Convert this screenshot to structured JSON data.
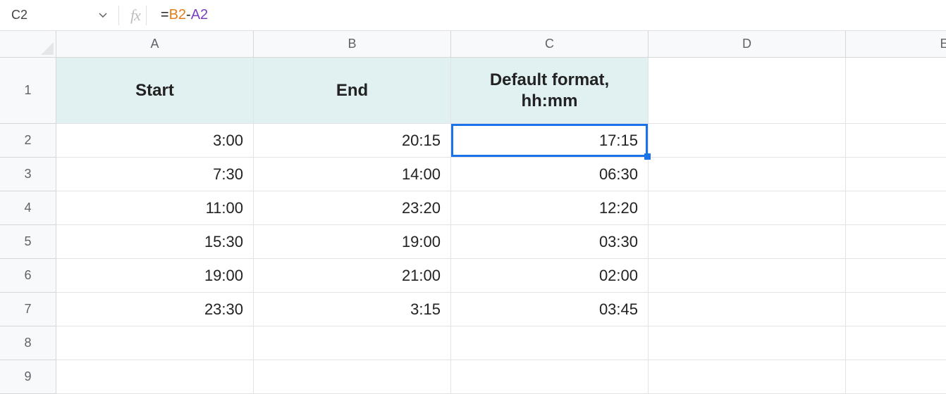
{
  "name_box": {
    "value": "C2"
  },
  "formula": {
    "eq": "=",
    "ref1": "B2",
    "op": "-",
    "ref2": "A2"
  },
  "columns": [
    "A",
    "B",
    "C",
    "D",
    "E"
  ],
  "row_numbers": [
    "1",
    "2",
    "3",
    "4",
    "5",
    "6",
    "7",
    "8",
    "9"
  ],
  "headers": {
    "a": "Start",
    "b": "End",
    "c": "Default format,\nhh:mm"
  },
  "rows": [
    {
      "a": "3:00",
      "b": "20:15",
      "c": "17:15"
    },
    {
      "a": "7:30",
      "b": "14:00",
      "c": "06:30"
    },
    {
      "a": "11:00",
      "b": "23:20",
      "c": "12:20"
    },
    {
      "a": "15:30",
      "b": "19:00",
      "c": "03:30"
    },
    {
      "a": "19:00",
      "b": "21:00",
      "c": "02:00"
    },
    {
      "a": "23:30",
      "b": "3:15",
      "c": "03:45"
    }
  ],
  "chart_data": {
    "type": "table",
    "title": "",
    "columns": [
      "Start",
      "End",
      "Default format, hh:mm"
    ],
    "rows": [
      [
        "3:00",
        "20:15",
        "17:15"
      ],
      [
        "7:30",
        "14:00",
        "06:30"
      ],
      [
        "11:00",
        "23:20",
        "12:20"
      ],
      [
        "15:30",
        "19:00",
        "03:30"
      ],
      [
        "19:00",
        "21:00",
        "02:00"
      ],
      [
        "23:30",
        "3:15",
        "03:45"
      ]
    ]
  }
}
